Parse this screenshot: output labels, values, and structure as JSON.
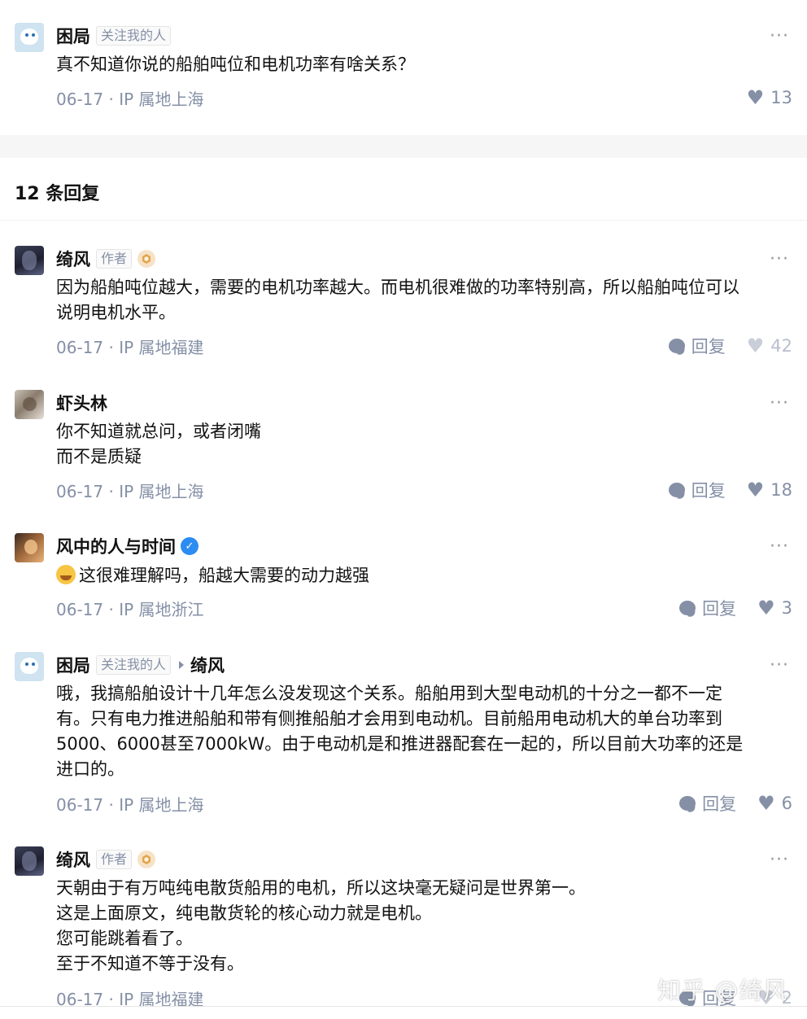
{
  "top_comment": {
    "username": "困局",
    "tag": "关注我的人",
    "text": "真不知道你说的船舶吨位和电机功率有啥关系？",
    "meta": "06-17 · IP 属地上海",
    "likes": "13"
  },
  "replies_header": "12 条回复",
  "more_icon": "···",
  "replies": [
    {
      "username": "绮风",
      "tag": "作者",
      "lines": [
        "因为船舶吨位越大，需要的电机功率越大。而电机很难做的功率特别高，所以船舶吨位可以",
        "说明电机水平。"
      ],
      "meta": "06-17 · IP 属地福建",
      "reply_label": "回复",
      "likes": "42"
    },
    {
      "username": "虾头林",
      "lines": [
        "你不知道就总问，或者闭嘴",
        "而不是质疑"
      ],
      "meta": "06-17 · IP 属地上海",
      "reply_label": "回复",
      "likes": "18"
    },
    {
      "username": "风中的人与时间",
      "verified_mark": "✓",
      "lines": [
        "这很难理解吗，船越大需要的动力越强"
      ],
      "meta": "06-17 · IP 属地浙江",
      "reply_label": "回复",
      "likes": "3"
    },
    {
      "username": "困局",
      "tag": "关注我的人",
      "reply_to": "绮风",
      "lines": [
        "哦，我搞船舶设计十几年怎么没发现这个关系。船舶用到大型电动机的十分之一都不一定",
        "有。只有电力推进船舶和带有侧推船舶才会用到电动机。目前船用电动机大的单台功率到",
        "5000、6000甚至7000kW。由于电动机是和推进器配套在一起的，所以目前大功率的还是",
        "进口的。"
      ],
      "meta": "06-17 · IP 属地上海",
      "reply_label": "回复",
      "likes": "6"
    },
    {
      "username": "绮风",
      "tag": "作者",
      "lines": [
        "天朝由于有万吨纯电散货船用的电机，所以这块毫无疑问是世界第一。",
        "这是上面原文，纯电散货轮的核心动力就是电机。",
        "您可能跳着看了。",
        "至于不知道不等于没有。"
      ],
      "meta": "06-17 · IP 属地福建",
      "reply_label": "回复",
      "likes": "2"
    }
  ],
  "watermark": "知乎 @绮风"
}
